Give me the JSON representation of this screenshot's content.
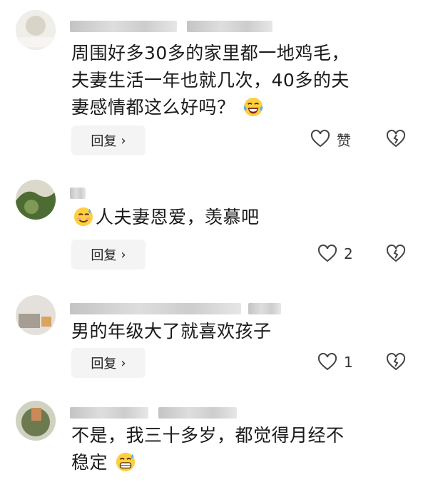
{
  "comments": [
    {
      "text_lines": [
        "周围好多30多的家里都一地鸡毛，",
        "夫妻生活一年也就几次，40多的夫",
        "妻感情都这么好吗？"
      ],
      "emoji": "laughing-tears-emoji",
      "reply_label": "回复",
      "like_label": "赞",
      "avatar_color": "#e8e6de"
    },
    {
      "text_lines": [
        "人夫妻恩爱，羡慕吧"
      ],
      "emoji": "sweat-smile-emoji",
      "reply_label": "回复",
      "like_label": "2",
      "avatar_color": "#5e7d3f"
    },
    {
      "text_lines": [
        "男的年级大了就喜欢孩子"
      ],
      "emoji": "",
      "reply_label": "回复",
      "like_label": "1",
      "avatar_color": "#c9c4bd"
    },
    {
      "text_lines": [
        "不是，我三十多岁，都觉得月经不",
        "稳定"
      ],
      "emoji": "grinning-sweat-emoji",
      "reply_label": "",
      "like_label": "",
      "avatar_color": "#6d7a50"
    }
  ],
  "icons": {
    "reply_chevron": "chevron-right-icon",
    "like": "heart-outline-icon",
    "dislike": "broken-heart-icon"
  },
  "colors": {
    "text": "#1a1a1a",
    "reply_bg": "#f4f4f4",
    "icon": "#444444"
  }
}
